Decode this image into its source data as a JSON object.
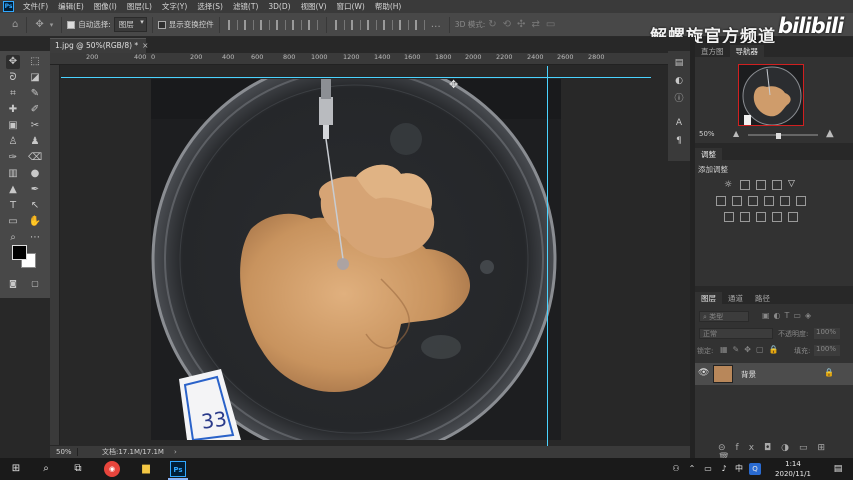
{
  "app": {
    "logo_text": "Ps",
    "menu": [
      "文件(F)",
      "编辑(E)",
      "图像(I)",
      "图层(L)",
      "文字(Y)",
      "选择(S)",
      "滤镜(T)",
      "3D(D)",
      "视图(V)",
      "窗口(W)",
      "帮助(H)"
    ]
  },
  "options_bar": {
    "auto_select_label": "自动选择:",
    "auto_select_checked": true,
    "auto_select_value": "图层",
    "show_transform_label": "显示变换控件",
    "show_transform_checked": false,
    "mode_3d_label": "3D 模式:"
  },
  "watermark": {
    "text": "解螺旋官方频道",
    "logo": "bilibili"
  },
  "document": {
    "tab_title": "1.jpg @ 50%(RGB/8) *",
    "ruler_ticks": [
      "200",
      "400",
      "0",
      "200",
      "400",
      "600",
      "800",
      "1000",
      "1200",
      "1400",
      "1600",
      "1800",
      "2000",
      "2200",
      "2400",
      "2600",
      "2800"
    ],
    "status_zoom": "50%",
    "status_doc": "文档:17.1M/17.1M",
    "label_card_text": "33"
  },
  "panels": {
    "nav_tabs": [
      "直方图",
      "导航器"
    ],
    "nav_active": "导航器",
    "nav_zoom": "50%",
    "adjust_tab": "调整",
    "adjust_hint": "添加调整",
    "layer_tabs": [
      "图层",
      "通道",
      "路径"
    ],
    "layer_filter": "类型",
    "blend_mode": "正常",
    "opacity_label": "不透明度:",
    "opacity_value": "100%",
    "lock_label": "锁定:",
    "fill_label": "填充:",
    "fill_value": "100%",
    "layer_name": "背景"
  },
  "taskbar": {
    "time": "1:14",
    "date": "2020/11/1",
    "ime": "中",
    "ime2": "Q"
  },
  "colors": {
    "guide": "#4ad3ff",
    "nav_frame": "#d12020",
    "accent_ps": "#31a8ff"
  }
}
